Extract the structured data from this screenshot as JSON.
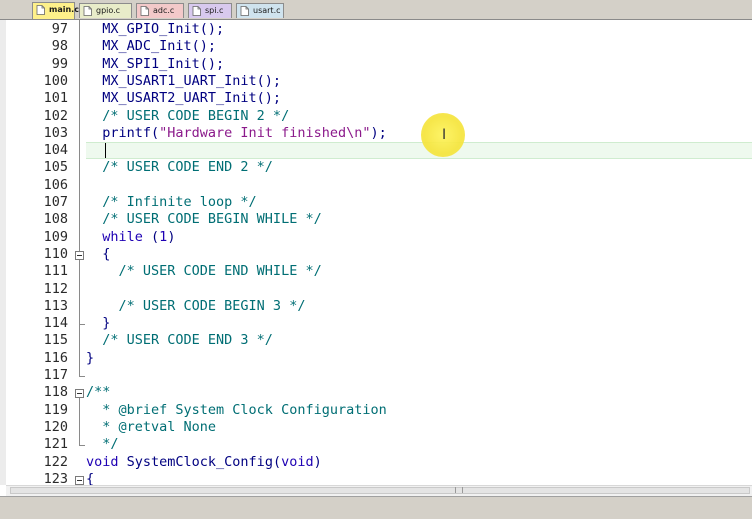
{
  "tabs": [
    {
      "label": "main.c",
      "color": "#fef08a",
      "active": true
    },
    {
      "label": "gpio.c",
      "color": "#e8ecc9",
      "active": false
    },
    {
      "label": "adc.c",
      "color": "#f3c9c9",
      "active": false
    },
    {
      "label": "spi.c",
      "color": "#d8c9ee",
      "active": false
    },
    {
      "label": "usart.c",
      "color": "#cfe3ee",
      "active": false
    }
  ],
  "editor": {
    "current_line": "104",
    "lines": [
      {
        "n": "97",
        "segs": [
          {
            "t": "  MX_GPIO_Init();",
            "c": "plain"
          }
        ]
      },
      {
        "n": "98",
        "segs": [
          {
            "t": "  MX_ADC_Init();",
            "c": "plain"
          }
        ]
      },
      {
        "n": "99",
        "segs": [
          {
            "t": "  MX_SPI1_Init();",
            "c": "plain"
          }
        ]
      },
      {
        "n": "100",
        "segs": [
          {
            "t": "  MX_USART1_UART_Init();",
            "c": "plain"
          }
        ]
      },
      {
        "n": "101",
        "segs": [
          {
            "t": "  MX_USART2_UART_Init();",
            "c": "plain"
          }
        ]
      },
      {
        "n": "102",
        "segs": [
          {
            "t": "  /* USER CODE BEGIN 2 */",
            "c": "cm"
          }
        ]
      },
      {
        "n": "103",
        "segs": [
          {
            "t": "  printf(",
            "c": "plain"
          },
          {
            "t": "\"Hardware Init finished\\n\"",
            "c": "str"
          },
          {
            "t": ");",
            "c": "plain"
          }
        ]
      },
      {
        "n": "104",
        "segs": []
      },
      {
        "n": "105",
        "segs": [
          {
            "t": "  /* USER CODE END 2 */",
            "c": "cm"
          }
        ]
      },
      {
        "n": "106",
        "segs": []
      },
      {
        "n": "107",
        "segs": [
          {
            "t": "  /* Infinite loop */",
            "c": "cm"
          }
        ]
      },
      {
        "n": "108",
        "segs": [
          {
            "t": "  /* USER CODE BEGIN WHILE */",
            "c": "cm"
          }
        ]
      },
      {
        "n": "109",
        "segs": [
          {
            "t": "  ",
            "c": "plain"
          },
          {
            "t": "while",
            "c": "kw"
          },
          {
            "t": " (",
            "c": "plain"
          },
          {
            "t": "1",
            "c": "num"
          },
          {
            "t": ")",
            "c": "plain"
          }
        ]
      },
      {
        "n": "110",
        "segs": [
          {
            "t": "  {",
            "c": "plain"
          }
        ]
      },
      {
        "n": "111",
        "segs": [
          {
            "t": "    /* USER CODE END WHILE */",
            "c": "cm"
          }
        ]
      },
      {
        "n": "112",
        "segs": []
      },
      {
        "n": "113",
        "segs": [
          {
            "t": "    /* USER CODE BEGIN 3 */",
            "c": "cm"
          }
        ]
      },
      {
        "n": "114",
        "segs": [
          {
            "t": "  }",
            "c": "plain"
          }
        ]
      },
      {
        "n": "115",
        "segs": [
          {
            "t": "  /* USER CODE END 3 */",
            "c": "cm"
          }
        ]
      },
      {
        "n": "116",
        "segs": [
          {
            "t": "}",
            "c": "plain"
          }
        ]
      },
      {
        "n": "117",
        "segs": []
      },
      {
        "n": "118",
        "segs": [
          {
            "t": "/**",
            "c": "cm"
          }
        ]
      },
      {
        "n": "119",
        "segs": [
          {
            "t": "  * @brief System Clock Configuration",
            "c": "cm"
          }
        ]
      },
      {
        "n": "120",
        "segs": [
          {
            "t": "  * @retval None",
            "c": "cm"
          }
        ]
      },
      {
        "n": "121",
        "segs": [
          {
            "t": "  */",
            "c": "cm"
          }
        ]
      },
      {
        "n": "122",
        "segs": [
          {
            "t": "void",
            "c": "kw"
          },
          {
            "t": " SystemClock_Config(",
            "c": "plain"
          },
          {
            "t": "void",
            "c": "kw"
          },
          {
            "t": ")",
            "c": "plain"
          }
        ]
      },
      {
        "n": "123",
        "segs": [
          {
            "t": "{",
            "c": "plain"
          }
        ]
      }
    ]
  },
  "icons": {
    "file_icon": "file-icon",
    "cursor": "text-cursor-icon",
    "fold": "fold-toggle-icon"
  },
  "colors": {
    "comment": "#006e74",
    "keyword": "#1e00b4",
    "string": "#8b1a8b",
    "identifier": "#000080",
    "current_line_bg": "#eef9ee",
    "cursor_highlight": "#fdf35a"
  }
}
